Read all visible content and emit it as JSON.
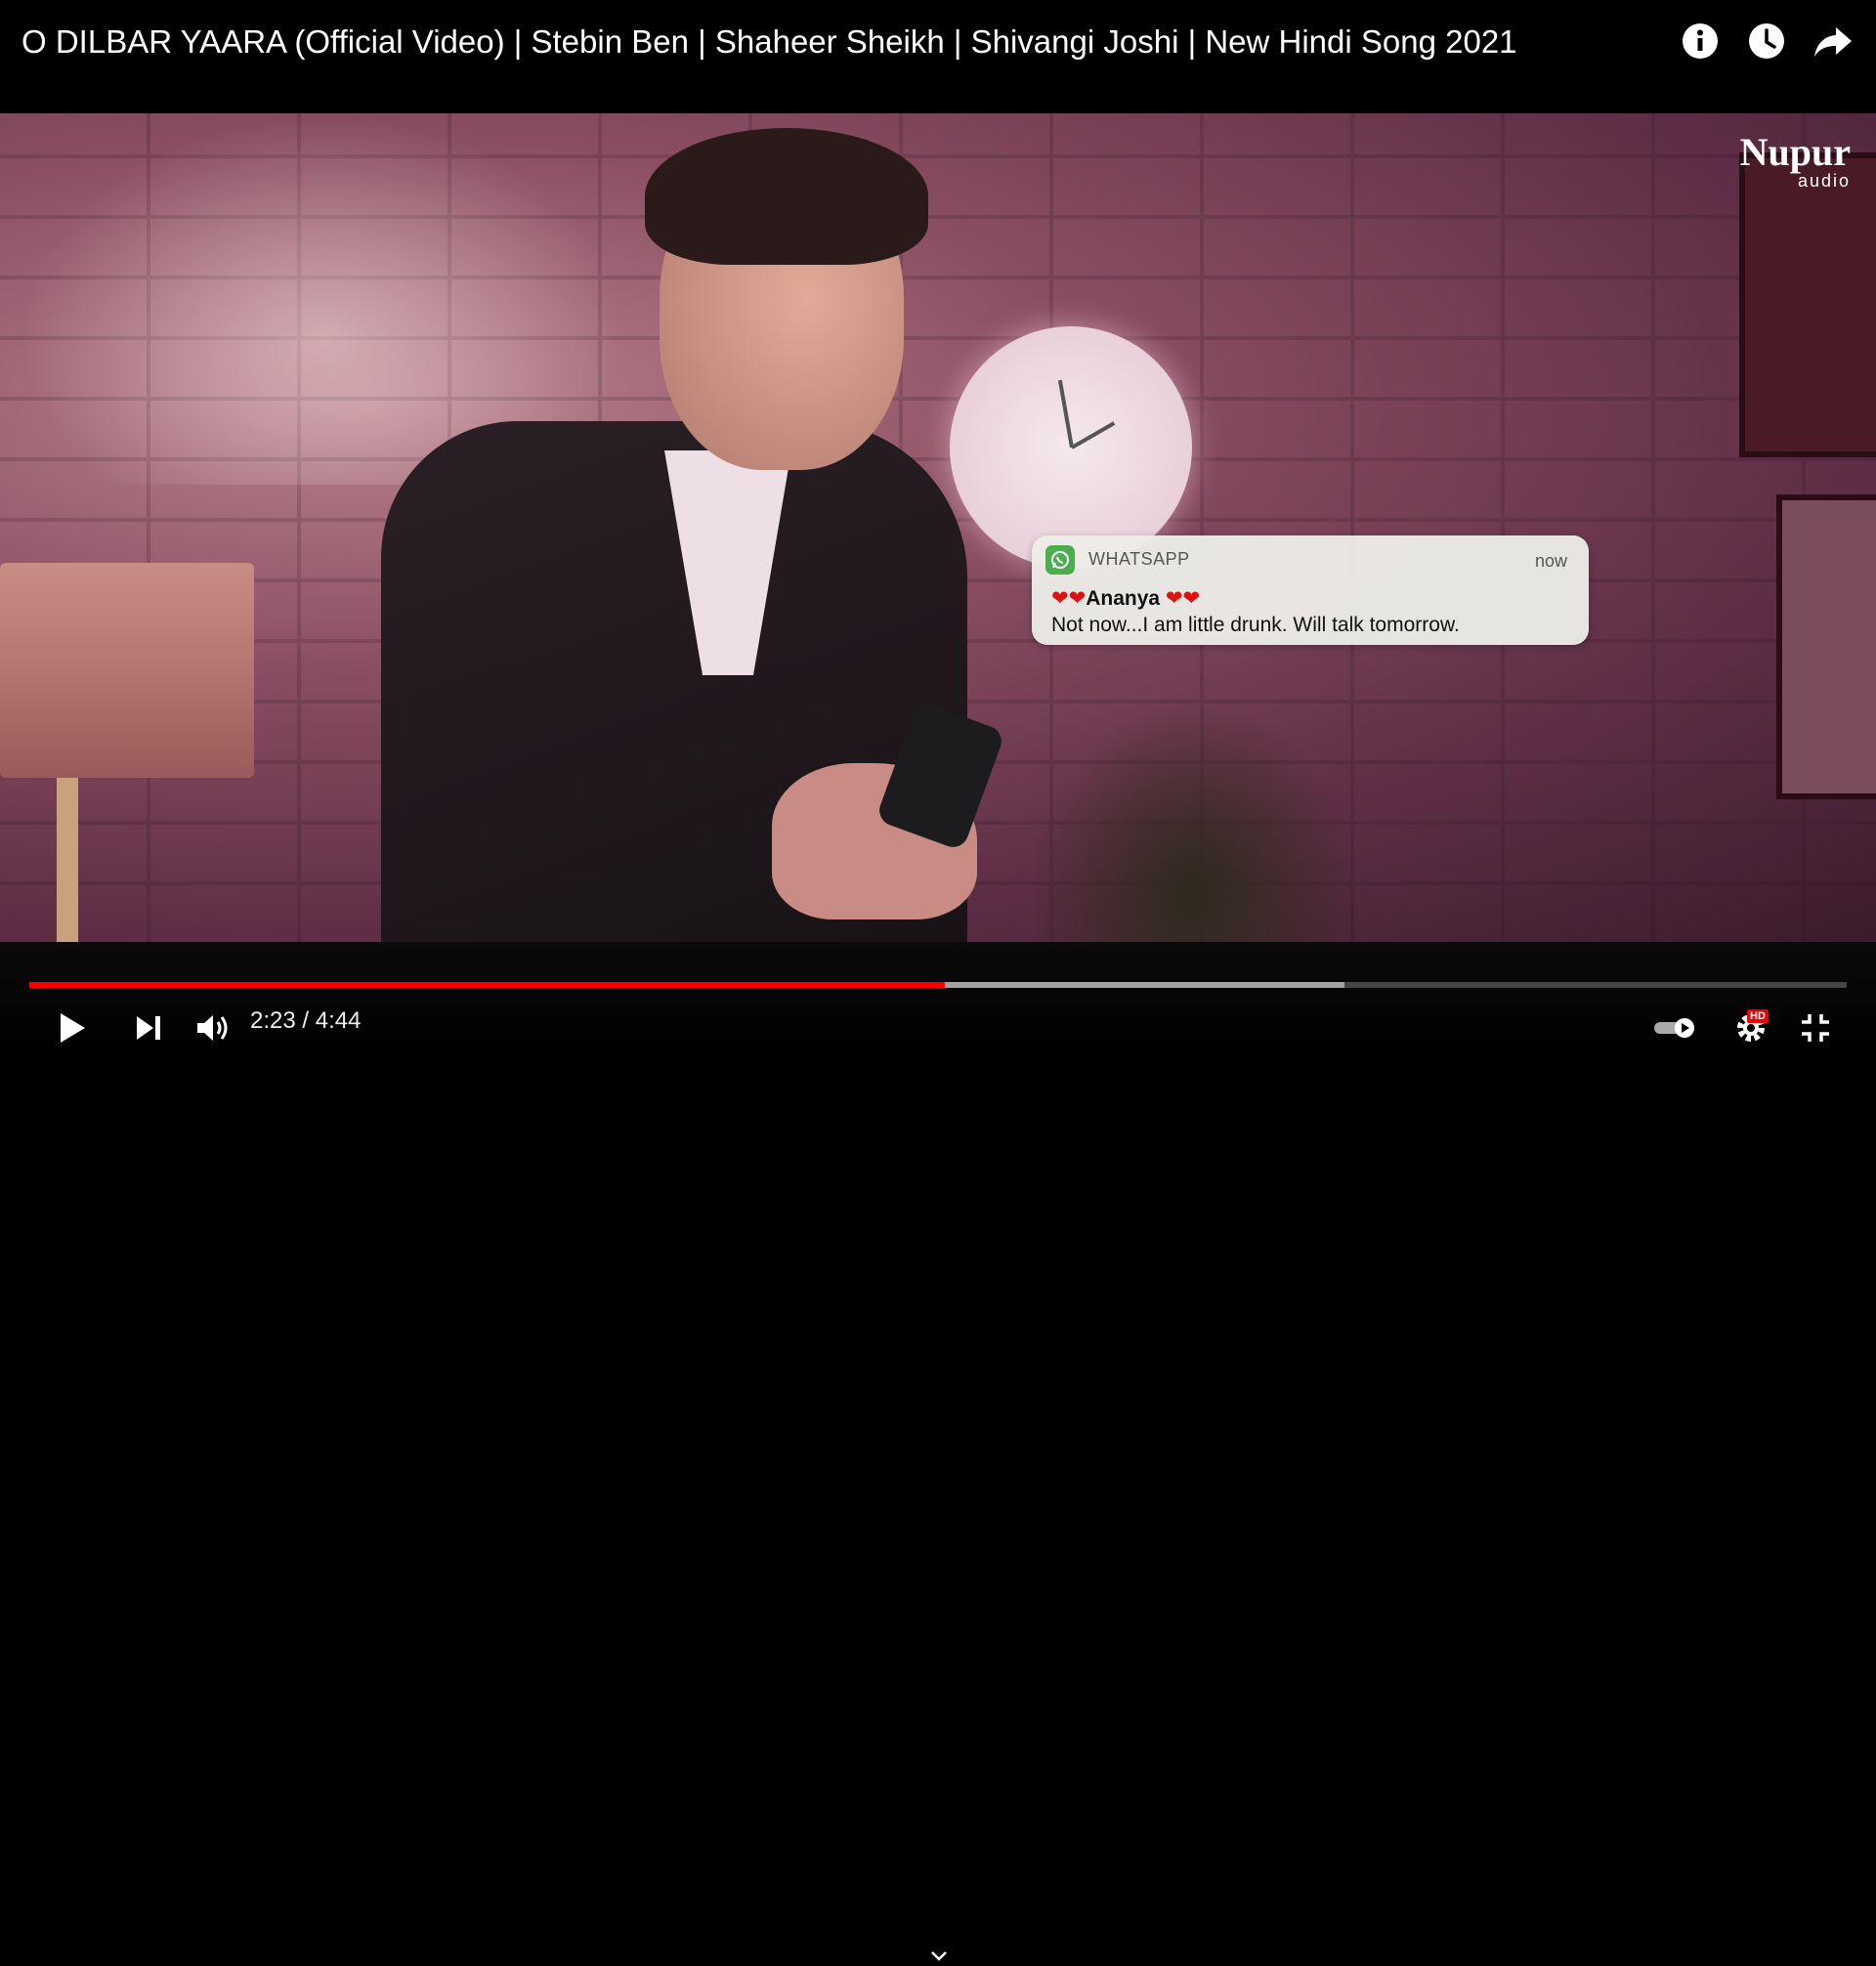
{
  "video": {
    "title": "O DILBAR YAARA (Official Video) | Stebin Ben | Shaheer Sheikh | Shivangi Joshi | New Hindi Song 2021",
    "watermark": {
      "name": "Nupur",
      "sub": "audio"
    }
  },
  "top_icons": [
    "info-icon",
    "watch-later-icon",
    "share-icon"
  ],
  "notification": {
    "app": "WHATSAPP",
    "time": "now",
    "hearts_left": "❤❤",
    "sender": "Ananya",
    "hearts_right": "❤❤",
    "message": "Not now...I am little drunk. Will talk tomorrow."
  },
  "player": {
    "current_time": "2:23",
    "duration": "4:44",
    "time_text": "2:23 / 4:44",
    "played_fraction": 0.5036,
    "buffered_fraction": 0.7237,
    "hd_badge": "HD",
    "accent_color": "#ff0000"
  }
}
